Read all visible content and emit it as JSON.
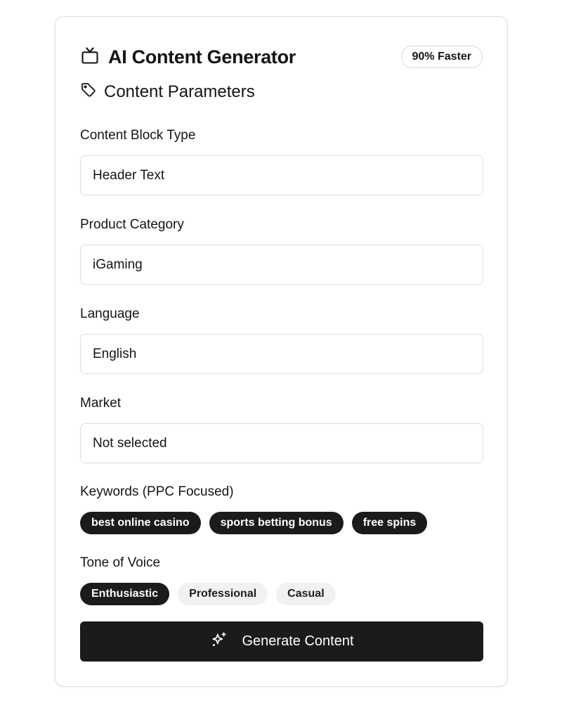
{
  "header": {
    "title": "AI Content Generator",
    "title_icon": "tv-icon",
    "badge": "90% Faster"
  },
  "section": {
    "title": "Content Parameters",
    "icon": "tag-icon"
  },
  "fields": [
    {
      "label": "Content Block Type",
      "value": "Header Text"
    },
    {
      "label": "Product Category",
      "value": "iGaming"
    },
    {
      "label": "Language",
      "value": "English"
    },
    {
      "label": "Market",
      "value": "Not selected"
    }
  ],
  "keywords": {
    "label": "Keywords (PPC Focused)",
    "items": [
      "best online casino",
      "sports betting bonus",
      "free spins"
    ]
  },
  "tone": {
    "label": "Tone of Voice",
    "options": [
      {
        "label": "Enthusiastic",
        "selected": true
      },
      {
        "label": "Professional",
        "selected": false
      },
      {
        "label": "Casual",
        "selected": false
      }
    ]
  },
  "action": {
    "label": "Generate Content",
    "icon": "sparkles-icon"
  },
  "colors": {
    "primary": "#1b1b1c",
    "chip_inactive": "#f1f1f1",
    "border": "#dedede"
  }
}
